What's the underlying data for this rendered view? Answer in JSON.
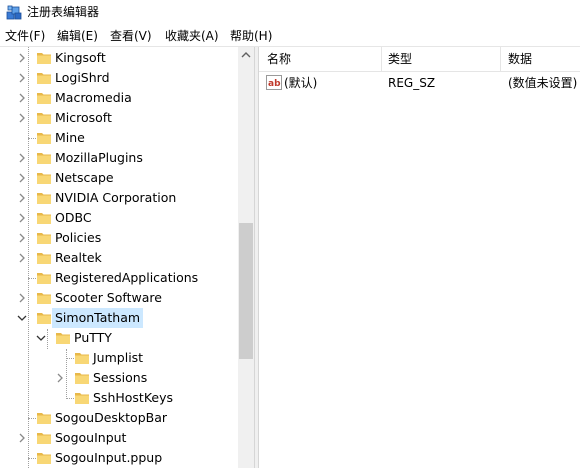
{
  "window": {
    "title": "注册表编辑器"
  },
  "menu": [
    "文件(F)",
    "编辑(E)",
    "查看(V)",
    "收藏夹(A)",
    "帮助(H)"
  ],
  "tree": {
    "items": [
      {
        "label": "Kingsoft",
        "expandable": true
      },
      {
        "label": "LogiShrd",
        "expandable": true
      },
      {
        "label": "Macromedia",
        "expandable": true
      },
      {
        "label": "Microsoft",
        "expandable": true
      },
      {
        "label": "Mine",
        "expandable": false
      },
      {
        "label": "MozillaPlugins",
        "expandable": true
      },
      {
        "label": "Netscape",
        "expandable": true
      },
      {
        "label": "NVIDIA Corporation",
        "expandable": true
      },
      {
        "label": "ODBC",
        "expandable": true
      },
      {
        "label": "Policies",
        "expandable": true
      },
      {
        "label": "Realtek",
        "expandable": true
      },
      {
        "label": "RegisteredApplications",
        "expandable": false
      },
      {
        "label": "Scooter Software",
        "expandable": true
      },
      {
        "label": "SimonTatham",
        "expandable": true,
        "expanded": true,
        "selected": true
      },
      {
        "label": "PuTTY",
        "expandable": true,
        "expanded": true,
        "level": 2
      },
      {
        "label": "Jumplist",
        "expandable": false,
        "level": 3
      },
      {
        "label": "Sessions",
        "expandable": true,
        "level": 3
      },
      {
        "label": "SshHostKeys",
        "expandable": false,
        "level": 3
      },
      {
        "label": "SogouDesktopBar",
        "expandable": false
      },
      {
        "label": "SogouInput",
        "expandable": true
      },
      {
        "label": "SogouInput.ppup",
        "expandable": false
      }
    ]
  },
  "values_list": {
    "columns": [
      "名称",
      "类型",
      "数据"
    ],
    "rows": [
      {
        "name": "(默认)",
        "type": "REG_SZ",
        "data": "(数值未设置)"
      }
    ]
  },
  "colors": {
    "selection": "#cce8ff",
    "folder": "#f8d775"
  }
}
